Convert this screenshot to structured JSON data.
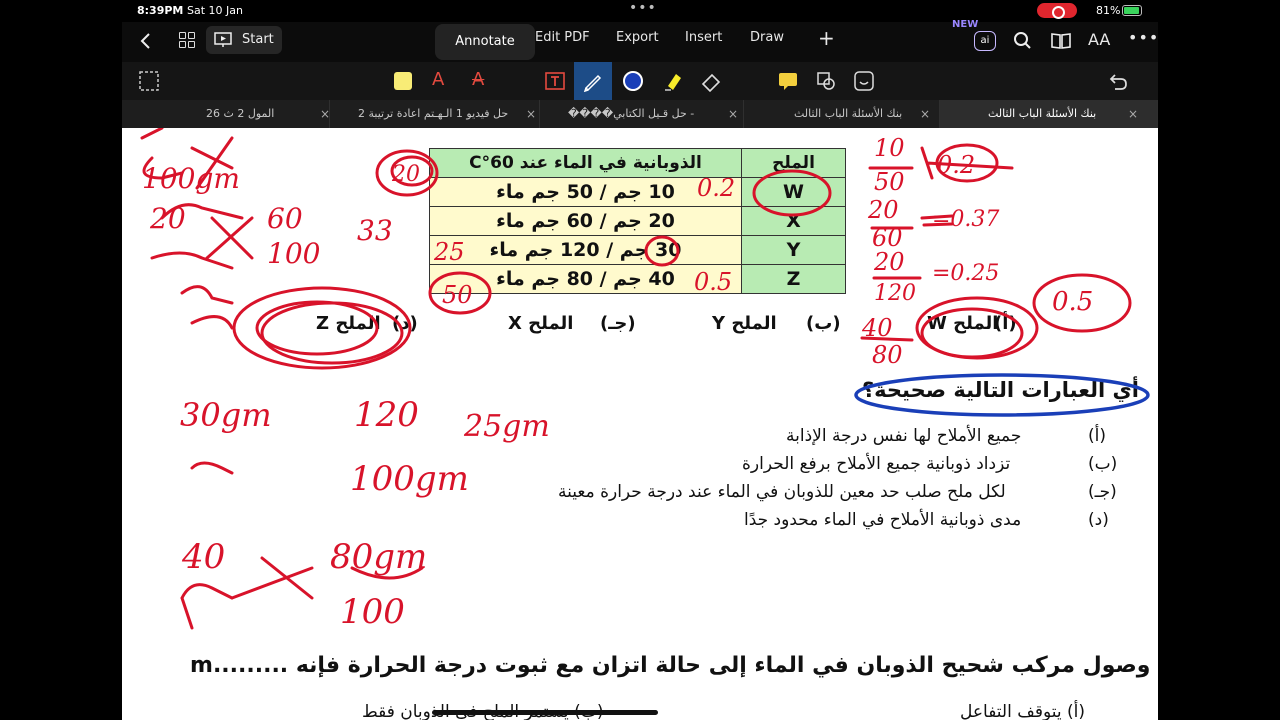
{
  "status_bar": {
    "time": "8:39PM",
    "date": "Sat 10 Jan",
    "battery": "81%"
  },
  "toolbar": {
    "start_label": "Start",
    "tabs": [
      "Annotate",
      "Edit PDF",
      "Export",
      "Insert",
      "Draw"
    ],
    "new_badge": "NEW",
    "ai_label": "ai"
  },
  "doc_tabs": [
    {
      "title": "بنك الأسئلة الباب الثالث",
      "active": true
    },
    {
      "title": "بنك الأسئلة الباب الثالث",
      "active": false
    },
    {
      "title": "����حل قـيل الكتابي  -",
      "active": false
    },
    {
      "title": "حل فيديو 1  الـهـتم اعادة ترتيبة 2",
      "active": false
    },
    {
      "title": "المول 2 ث 26",
      "active": false
    }
  ],
  "table": {
    "header_salt": "الملح",
    "header_solubility": "الذوبانية في الماء عند 60°C",
    "rows": [
      {
        "salt": "W",
        "value": "10 جم / 50 جم ماء"
      },
      {
        "salt": "X",
        "value": "20 جم / 60 جم ماء"
      },
      {
        "salt": "Y",
        "value": "30 جم / 120 جم ماء"
      },
      {
        "salt": "Z",
        "value": "40 جم / 80 جم ماء"
      }
    ]
  },
  "answer_options": [
    {
      "letter": "(أ)",
      "text": "الملح W"
    },
    {
      "letter": "(ب)",
      "text": "الملح Y"
    },
    {
      "letter": "(جـ)",
      "text": "الملح X"
    },
    {
      "letter": "(د)",
      "text": "الملح Z"
    }
  ],
  "question": {
    "title": "أي العبارات التالية صحيحة؟",
    "choices": [
      {
        "letter": "(أ)",
        "text": "جميع الأملاح لها نفس درجة الإذابة"
      },
      {
        "letter": "(ب)",
        "text": "تزداد ذوبانية جميع الأملاح برفع الحرارة"
      },
      {
        "letter": "(جـ)",
        "text": "لكل ملح صلب حد معين للذوبان في الماء عند درجة حرارة معينة"
      },
      {
        "letter": "(د)",
        "text": "مدى ذوبانية الأملاح في الماء محدود جدًا"
      }
    ]
  },
  "question5": {
    "text": "5 - عند وصول مركب شحيح الذوبان في الماء إلى حالة اتزان مع ثبوت درجة الحرارة فإنه .........m",
    "option_a": "(أ) يتوقف التفاعل",
    "option_b": "(ب) يستمر الملح في الذوبان فقط"
  },
  "handwriting": {
    "ratios": [
      "10/50",
      "20/60",
      "20/120",
      "40/80"
    ],
    "results": [
      "=0.2",
      "=0.37",
      "=0.25",
      "0.5"
    ],
    "notes": [
      "30gm",
      "120",
      "25gm",
      "100gm",
      "40",
      "80gm",
      "100",
      "0.2",
      "25",
      "50",
      "0.5",
      "60",
      "100",
      "33",
      "100gm",
      "20"
    ]
  },
  "colors": {
    "ink": "#d8132a",
    "pen_blue": "#1a3fb8",
    "toolbar_accent": "#1d4c87"
  }
}
